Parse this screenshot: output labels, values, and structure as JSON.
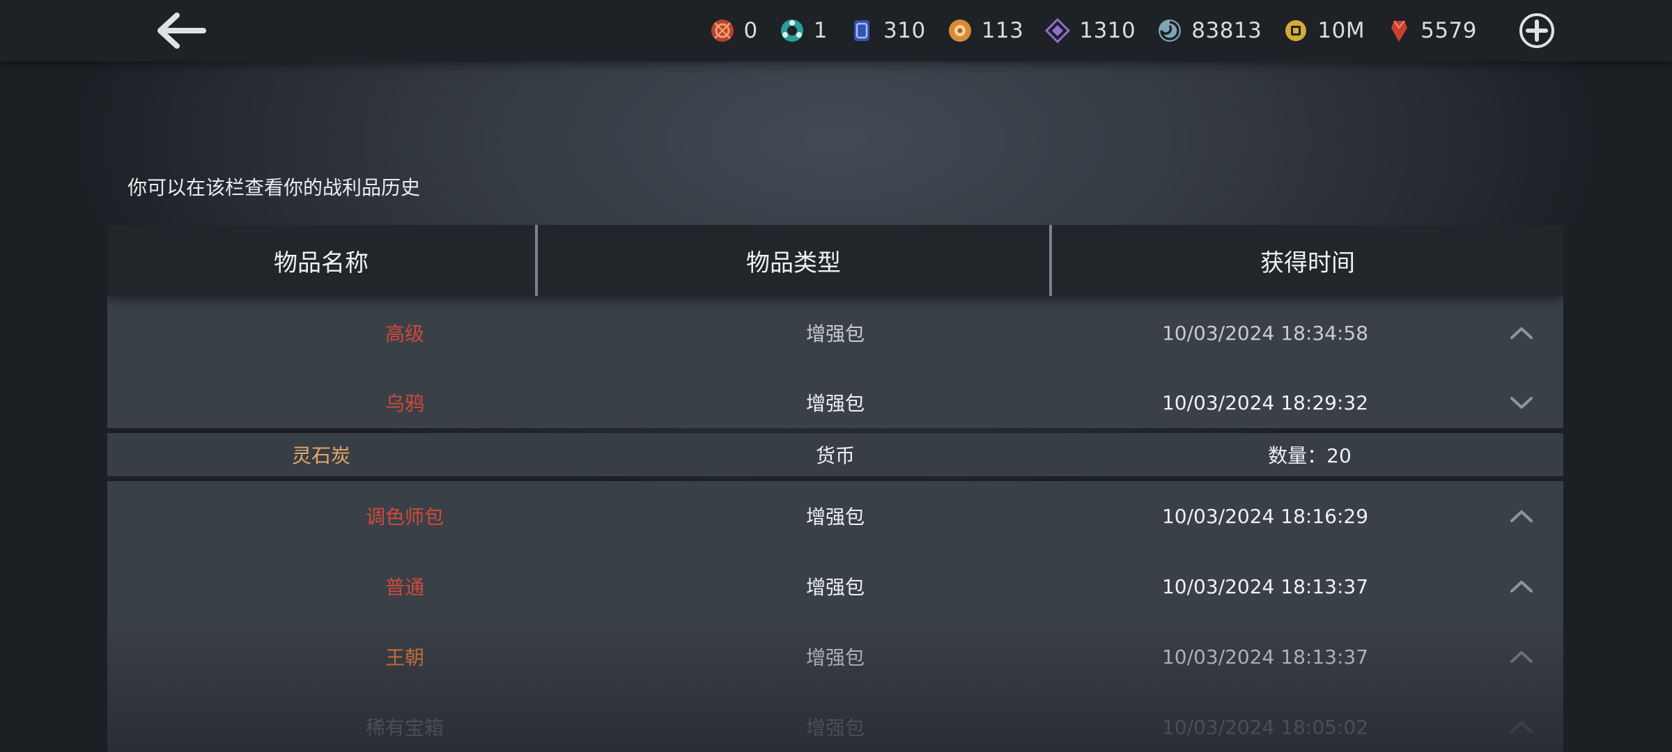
{
  "currencies": [
    {
      "icon": "red-crest-token-icon",
      "value": "0",
      "color": "#c9442f"
    },
    {
      "icon": "teal-wheel-token-icon",
      "value": "1",
      "color": "#3fb6ae"
    },
    {
      "icon": "blue-card-icon",
      "value": "310",
      "color": "#3f63c9"
    },
    {
      "icon": "orange-medallion-icon",
      "value": "113",
      "color": "#e0913a"
    },
    {
      "icon": "purple-diamond-icon",
      "value": "1310",
      "color": "#8a6cc9"
    },
    {
      "icon": "silver-swirl-icon",
      "value": "83813",
      "color": "#8fb8c9"
    },
    {
      "icon": "gold-coin-icon",
      "value": "10M",
      "color": "#d9b23a"
    },
    {
      "icon": "red-gem-icon",
      "value": "5579",
      "color": "#d24a3a"
    }
  ],
  "subtitle": "你可以在该栏查看你的战利品历史",
  "table": {
    "headers": [
      "物品名称",
      "物品类型",
      "获得时间"
    ],
    "rows": [
      {
        "name": "高级",
        "type": "增强包",
        "time": "10/03/2024 18:34:58",
        "chevron": "up",
        "name_color": "#d0493b"
      },
      {
        "name": "乌鸦",
        "type": "增强包",
        "time": "10/03/2024 18:29:32",
        "chevron": "down",
        "name_color": "#d0493b"
      },
      {
        "name": "调色师包",
        "type": "增强包",
        "time": "10/03/2024 18:16:29",
        "chevron": "up",
        "name_color": "#d0493b"
      },
      {
        "name": "普通",
        "type": "增强包",
        "time": "10/03/2024 18:13:37",
        "chevron": "up",
        "name_color": "#d0493b"
      },
      {
        "name": "王朝",
        "type": "增强包",
        "time": "10/03/2024 18:13:37",
        "chevron": "up",
        "name_color": "#e07a3e"
      },
      {
        "name": "稀有宝箱",
        "type": "增强包",
        "time": "10/03/2024 18:05:02",
        "chevron": "up",
        "name_color": "#9aa0a6"
      }
    ],
    "expanded_detail": {
      "name": "灵石炭",
      "type": "货币",
      "quantity": "数量：20",
      "name_color": "#e5a86a"
    }
  }
}
